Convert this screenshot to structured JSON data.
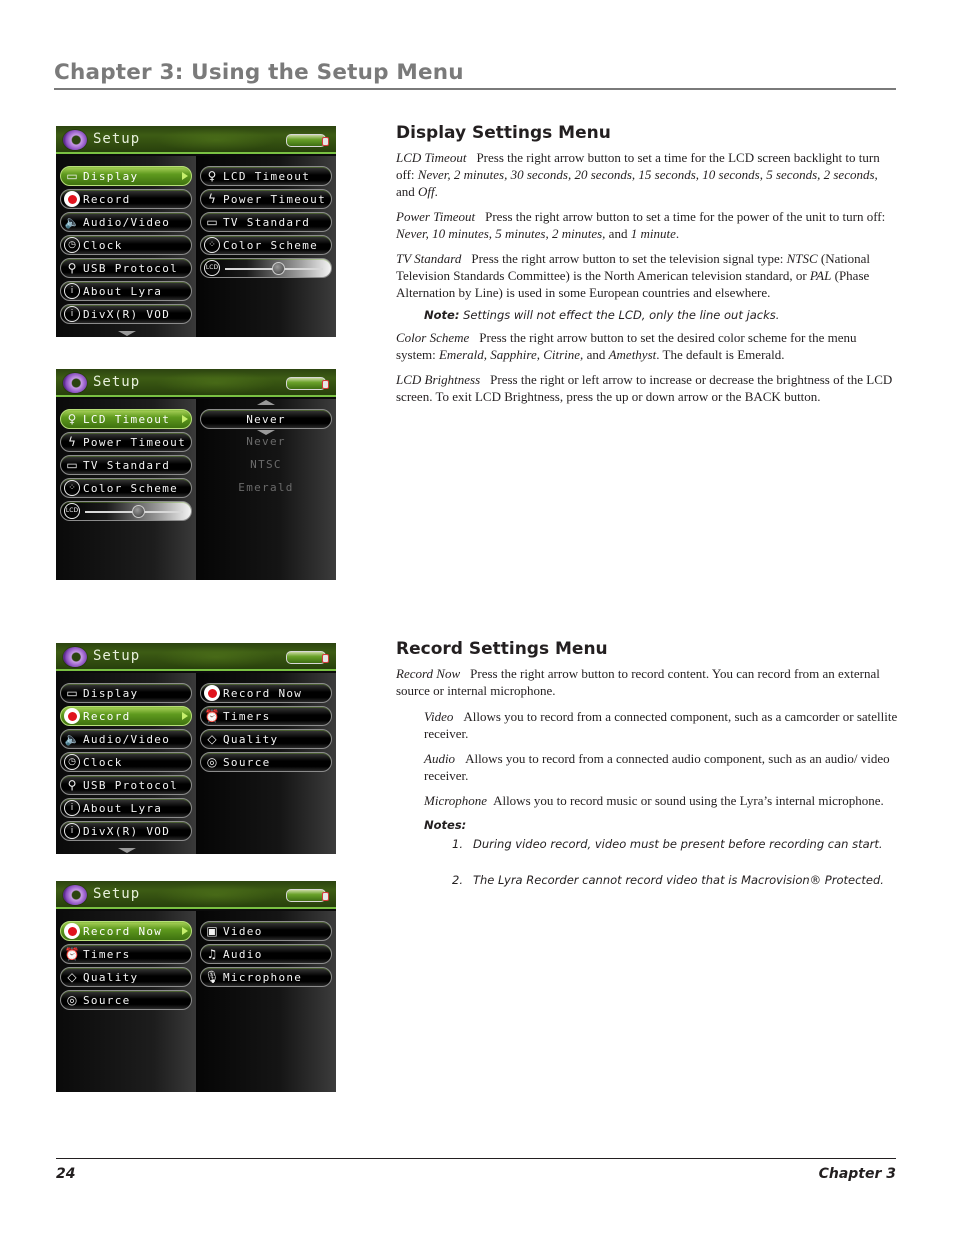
{
  "page": {
    "chapter_title": "Chapter 3: Using the Setup Menu",
    "footer_page_number": "24",
    "footer_chapter": "Chapter 3"
  },
  "screens": [
    {
      "title": "Setup",
      "left_items": [
        {
          "icon": "display-icon",
          "label": "Display",
          "active": true
        },
        {
          "icon": "record-icon",
          "label": "Record"
        },
        {
          "icon": "speaker-icon",
          "label": "Audio/Video"
        },
        {
          "icon": "clock-icon",
          "label": "Clock"
        },
        {
          "icon": "usb-icon",
          "label": "USB Protocol"
        },
        {
          "icon": "info-icon",
          "label": "About Lyra"
        },
        {
          "icon": "info-icon",
          "label": "DivX(R) VOD"
        }
      ],
      "right_items": [
        {
          "icon": "lightbulb-icon",
          "label": "LCD Timeout"
        },
        {
          "icon": "lightning-icon",
          "label": "Power Timeout"
        },
        {
          "icon": "tv-icon",
          "label": "TV Standard"
        },
        {
          "icon": "palette-icon",
          "label": "Color Scheme"
        },
        {
          "icon": "lcd-brightness-icon",
          "label": "",
          "slider_value": 0.55
        }
      ]
    },
    {
      "title": "Setup",
      "left_items": [
        {
          "icon": "lightbulb-icon",
          "label": "LCD Timeout",
          "active": true
        },
        {
          "icon": "lightning-icon",
          "label": "Power Timeout"
        },
        {
          "icon": "tv-icon",
          "label": "TV Standard"
        },
        {
          "icon": "palette-icon",
          "label": "Color Scheme"
        },
        {
          "icon": "lcd-brightness-icon",
          "label": "",
          "slider_value": 0.55
        }
      ],
      "selected_value": "Never",
      "other_values": [
        "Never",
        "NTSC",
        "Emerald"
      ]
    },
    {
      "title": "Setup",
      "left_items": [
        {
          "icon": "display-icon",
          "label": "Display"
        },
        {
          "icon": "record-icon",
          "label": "Record",
          "active": true
        },
        {
          "icon": "speaker-icon",
          "label": "Audio/Video"
        },
        {
          "icon": "clock-icon",
          "label": "Clock"
        },
        {
          "icon": "usb-icon",
          "label": "USB Protocol"
        },
        {
          "icon": "info-icon",
          "label": "About Lyra"
        },
        {
          "icon": "info-icon",
          "label": "DivX(R) VOD"
        }
      ],
      "right_items": [
        {
          "icon": "record-icon",
          "label": "Record Now"
        },
        {
          "icon": "alarm-clock-icon",
          "label": "Timers"
        },
        {
          "icon": "diamond-icon",
          "label": "Quality"
        },
        {
          "icon": "source-icon",
          "label": "Source"
        }
      ]
    },
    {
      "title": "Setup",
      "left_items": [
        {
          "icon": "record-icon",
          "label": "Record Now",
          "active": true
        },
        {
          "icon": "alarm-clock-icon",
          "label": "Timers"
        },
        {
          "icon": "diamond-icon",
          "label": "Quality"
        },
        {
          "icon": "source-icon",
          "label": "Source"
        }
      ],
      "right_items": [
        {
          "icon": "video-camera-icon",
          "label": "Video"
        },
        {
          "icon": "music-note-icon",
          "label": "Audio"
        },
        {
          "icon": "microphone-icon",
          "label": "Microphone"
        }
      ]
    }
  ],
  "display_section": {
    "heading": "Display Settings Menu",
    "lcd_timeout": {
      "term": "LCD Timeout",
      "text": "Press the right arrow button to set a time for the LCD screen backlight to turn off: ",
      "options": "Never, 2 minutes, 30 seconds, 20 seconds, 15 seconds, 10 seconds, 5 seconds, 2 seconds,",
      "and": " and ",
      "last": "Off",
      "end": "."
    },
    "power_timeout": {
      "term": "Power Timeout",
      "text": "Press the right arrow button to set a time for the power of the unit to turn off: ",
      "options": "Never, 10 minutes, 5 minutes, 2 minutes,",
      "and": " and ",
      "last": "1 minute",
      "end": "."
    },
    "tv_standard": {
      "term": "TV Standard",
      "text1": "Press the right arrow button to set the television signal type: ",
      "ntsc": "NTSC",
      "text2": " (National Television Standards Committee) is the North American television standard, or ",
      "pal": "PAL",
      "text3": " (Phase Alternation by Line) is used in some European countries and elsewhere."
    },
    "note": {
      "label": "Note:",
      "text": " Settings will not effect the LCD, only the line out jacks."
    },
    "color_scheme": {
      "term": "Color Scheme",
      "text": "Press the right arrow button to set the desired color scheme for the menu system: ",
      "options": "Emerald, Sapphire, Citrine,",
      "and": " and ",
      "last": "Amethyst",
      "end": ". The default is Emerald."
    },
    "lcd_brightness": {
      "term": "LCD Brightness",
      "text": "Press the right or left arrow to increase or decrease the brightness of the LCD screen. To exit LCD Brightness, press the up or down arrow or the BACK button."
    }
  },
  "record_section": {
    "heading": "Record Settings Menu",
    "record_now": {
      "term": "Record Now",
      "text": "Press the right arrow button to record content. You can record from an external source or internal microphone."
    },
    "video": {
      "term": "Video",
      "text": "Allows you to record from a connected component, such as a camcorder or satellite receiver."
    },
    "audio": {
      "term": "Audio",
      "text": "Allows you to record from a connected audio component, such as an audio/ video receiver."
    },
    "microphone": {
      "term": "Microphone",
      "text": "Allows you to record music or sound using the Lyra’s internal microphone."
    },
    "notes_label": "Notes:",
    "notes": [
      {
        "num": "1.",
        "text": "During video record, video must be present before recording can start."
      },
      {
        "num": "2.",
        "text": "The Lyra Recorder cannot record video that is Macrovision® Protected."
      }
    ]
  }
}
